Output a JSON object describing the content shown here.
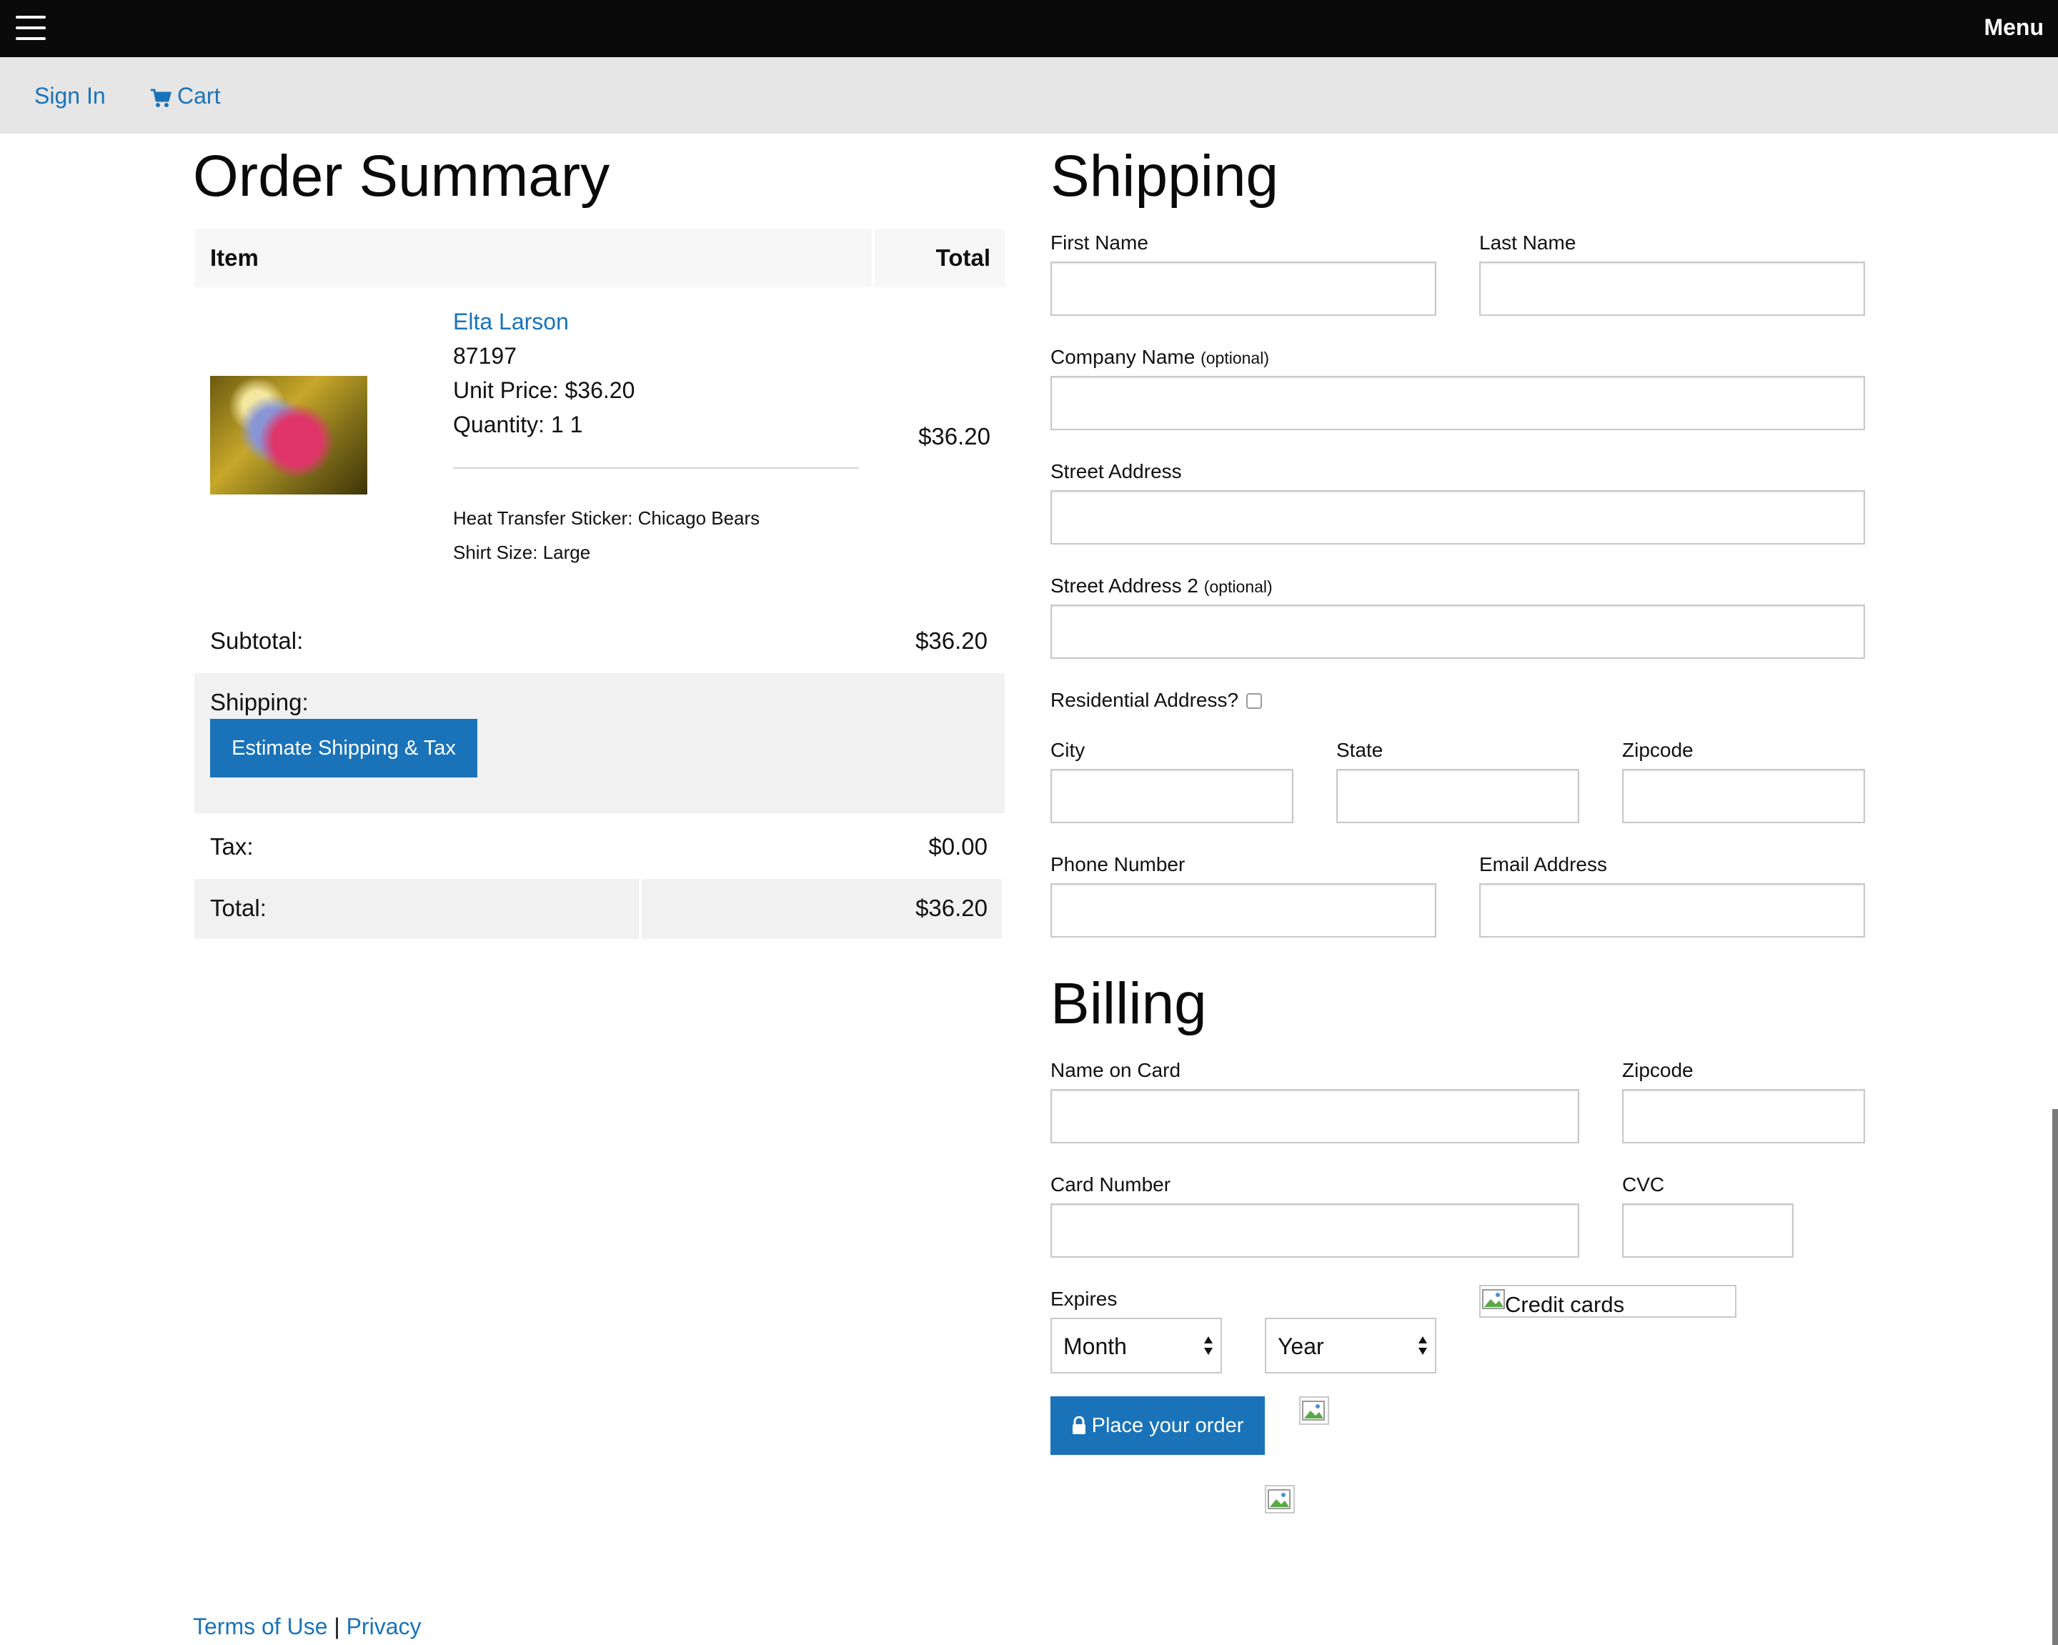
{
  "topbar": {
    "menu_label": "Menu"
  },
  "nav": {
    "sign_in": "Sign In",
    "cart": "Cart"
  },
  "summary": {
    "heading": "Order Summary",
    "col_item": "Item",
    "col_total": "Total",
    "item": {
      "name": "Elta Larson",
      "sku": "87197",
      "unit_price": "Unit Price: $36.20",
      "quantity": "Quantity: 1 1",
      "line_total": "$36.20",
      "option_1": "Heat Transfer Sticker: Chicago Bears",
      "option_2": "Shirt Size: Large"
    },
    "subtotal_label": "Subtotal:",
    "subtotal_value": "$36.20",
    "shipping_label": "Shipping:",
    "estimate_button": "Estimate Shipping & Tax",
    "tax_label": "Tax:",
    "tax_value": "$0.00",
    "total_label": "Total:",
    "total_value": "$36.20"
  },
  "shipping": {
    "heading": "Shipping",
    "first_name": "First Name",
    "last_name": "Last Name",
    "company": "Company Name",
    "company_opt": "(optional)",
    "street": "Street Address",
    "street2": "Street Address 2",
    "street2_opt": "(optional)",
    "residential": "Residential Address?",
    "city": "City",
    "state": "State",
    "zip": "Zipcode",
    "phone": "Phone Number",
    "email": "Email Address"
  },
  "billing": {
    "heading": "Billing",
    "name_on_card": "Name on Card",
    "zip": "Zipcode",
    "card_number": "Card Number",
    "cvc": "CVC",
    "expires": "Expires",
    "month": "Month",
    "year": "Year",
    "credit_cards_alt": "Credit cards",
    "place_order": "Place your order"
  },
  "footer": {
    "terms": "Terms of Use",
    "sep": "|",
    "privacy": "Privacy"
  },
  "colors": {
    "accent": "#1a73b8",
    "topbar": "#0a0a0a",
    "subnav": "#e6e6e6"
  }
}
